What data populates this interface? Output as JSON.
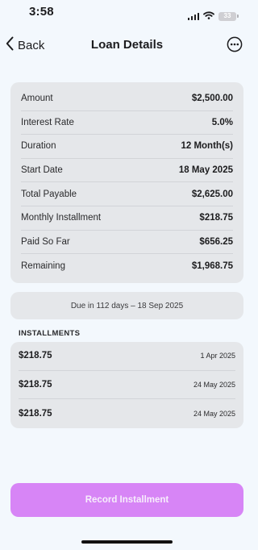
{
  "status_bar": {
    "time": "3:58",
    "battery": "33",
    "icons": [
      "signal-icon",
      "wifi-icon",
      "battery-icon"
    ]
  },
  "nav": {
    "back_label": "Back",
    "title": "Loan Details",
    "more_icon": "ellipsis-circle-icon"
  },
  "summary": {
    "rows": [
      {
        "label": "Amount",
        "value": "$2,500.00"
      },
      {
        "label": "Interest Rate",
        "value": "5.0%"
      },
      {
        "label": "Duration",
        "value": "12 Month(s)"
      },
      {
        "label": "Start Date",
        "value": "18 May 2025"
      },
      {
        "label": "Total Payable",
        "value": "$2,625.00"
      },
      {
        "label": "Monthly Installment",
        "value": "$218.75"
      },
      {
        "label": "Paid So Far",
        "value": "$656.25"
      },
      {
        "label": "Remaining",
        "value": "$1,968.75"
      }
    ]
  },
  "due_banner": "Due in 112 days – 18 Sep 2025",
  "installments": {
    "header": "INSTALLMENTS",
    "items": [
      {
        "amount": "$218.75",
        "date": "1 Apr 2025"
      },
      {
        "amount": "$218.75",
        "date": "24 May 2025"
      },
      {
        "amount": "$218.75",
        "date": "24 May 2025"
      }
    ]
  },
  "record_button": "Record Installment",
  "colors": {
    "background": "#f3f8fd",
    "card": "#e5e7ea",
    "accent": "#d785f6"
  }
}
